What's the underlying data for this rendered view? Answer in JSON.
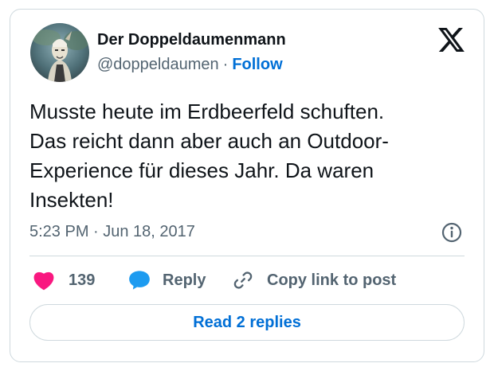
{
  "author": {
    "display_name": "Der Doppeldaumenmann",
    "handle": "@doppeldaumen",
    "separator": "·",
    "follow_label": "Follow",
    "avatar_icon": "avatar-knight-figure"
  },
  "brand": {
    "logo_icon": "x-logo-icon"
  },
  "tweet": {
    "text_lines": [
      "Musste heute im Erdbeerfeld schuften.",
      "Das reicht dann aber auch an Outdoor-",
      "Experience für dieses Jahr. Da waren",
      "Insekten!"
    ],
    "timestamp": "5:23 PM · Jun 18, 2017",
    "info_icon": "info-icon"
  },
  "actions": {
    "like_count": "139",
    "like_icon": "heart-icon",
    "reply_label": "Reply",
    "reply_icon": "speech-bubble-icon",
    "copy_label": "Copy link to post",
    "copy_icon": "link-icon"
  },
  "replies_button": {
    "label": "Read 2 replies"
  },
  "colors": {
    "link_blue": "#006fd6",
    "heart_red": "#f91880",
    "reply_blue": "#1d9bf0",
    "muted_text": "#536471",
    "border": "#cfd9de"
  }
}
